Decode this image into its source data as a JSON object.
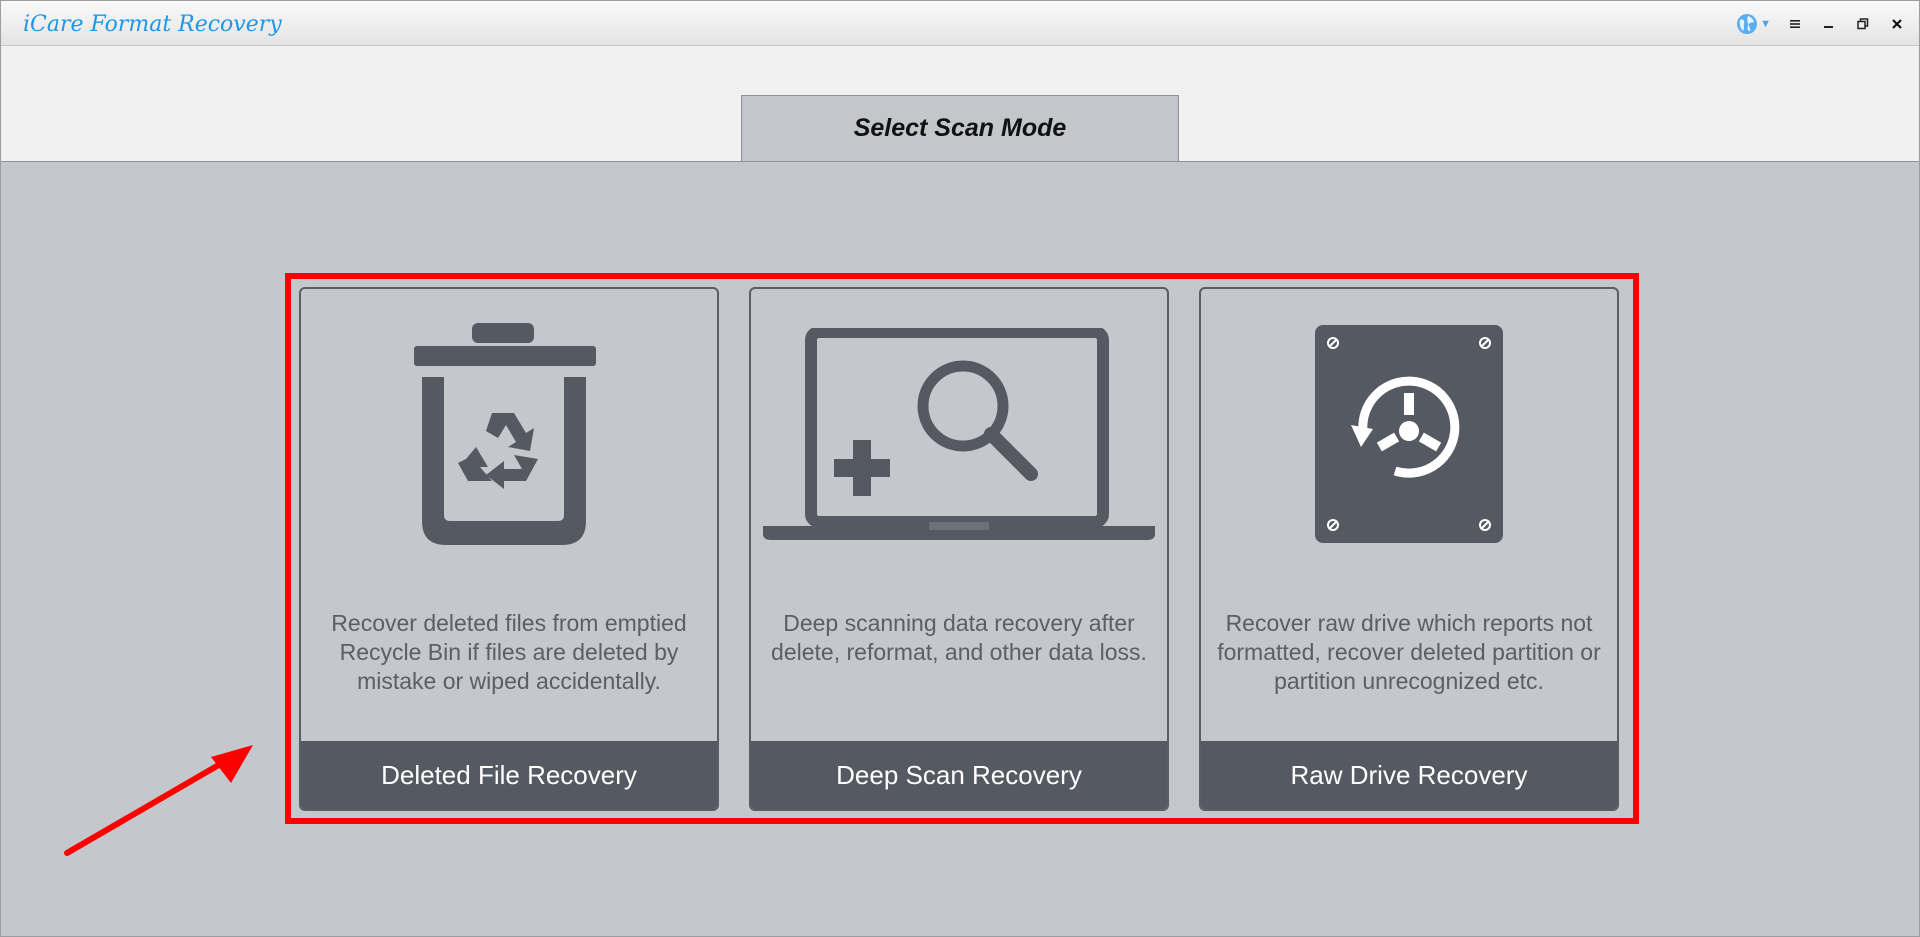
{
  "window": {
    "title": "iCare Format Recovery"
  },
  "tab": {
    "label": "Select Scan Mode"
  },
  "cards": [
    {
      "label": "Deleted File Recovery",
      "description": "Recover deleted files from emptied Recycle Bin if files are deleted by mistake or wiped accidentally.",
      "icon": "recycle-bin-icon"
    },
    {
      "label": "Deep Scan Recovery",
      "description": "Deep scanning data recovery after delete, reformat, and other data loss.",
      "icon": "laptop-search-icon"
    },
    {
      "label": "Raw Drive Recovery",
      "description": "Recover raw drive which reports not formatted, recover deleted partition or partition unrecognized etc.",
      "icon": "hard-drive-restore-icon"
    }
  ],
  "colors": {
    "title_blue": "#1e97e8",
    "panel_bg": "#c4c7cc",
    "icon_dark": "#555962",
    "highlight_red": "#ff0000"
  }
}
